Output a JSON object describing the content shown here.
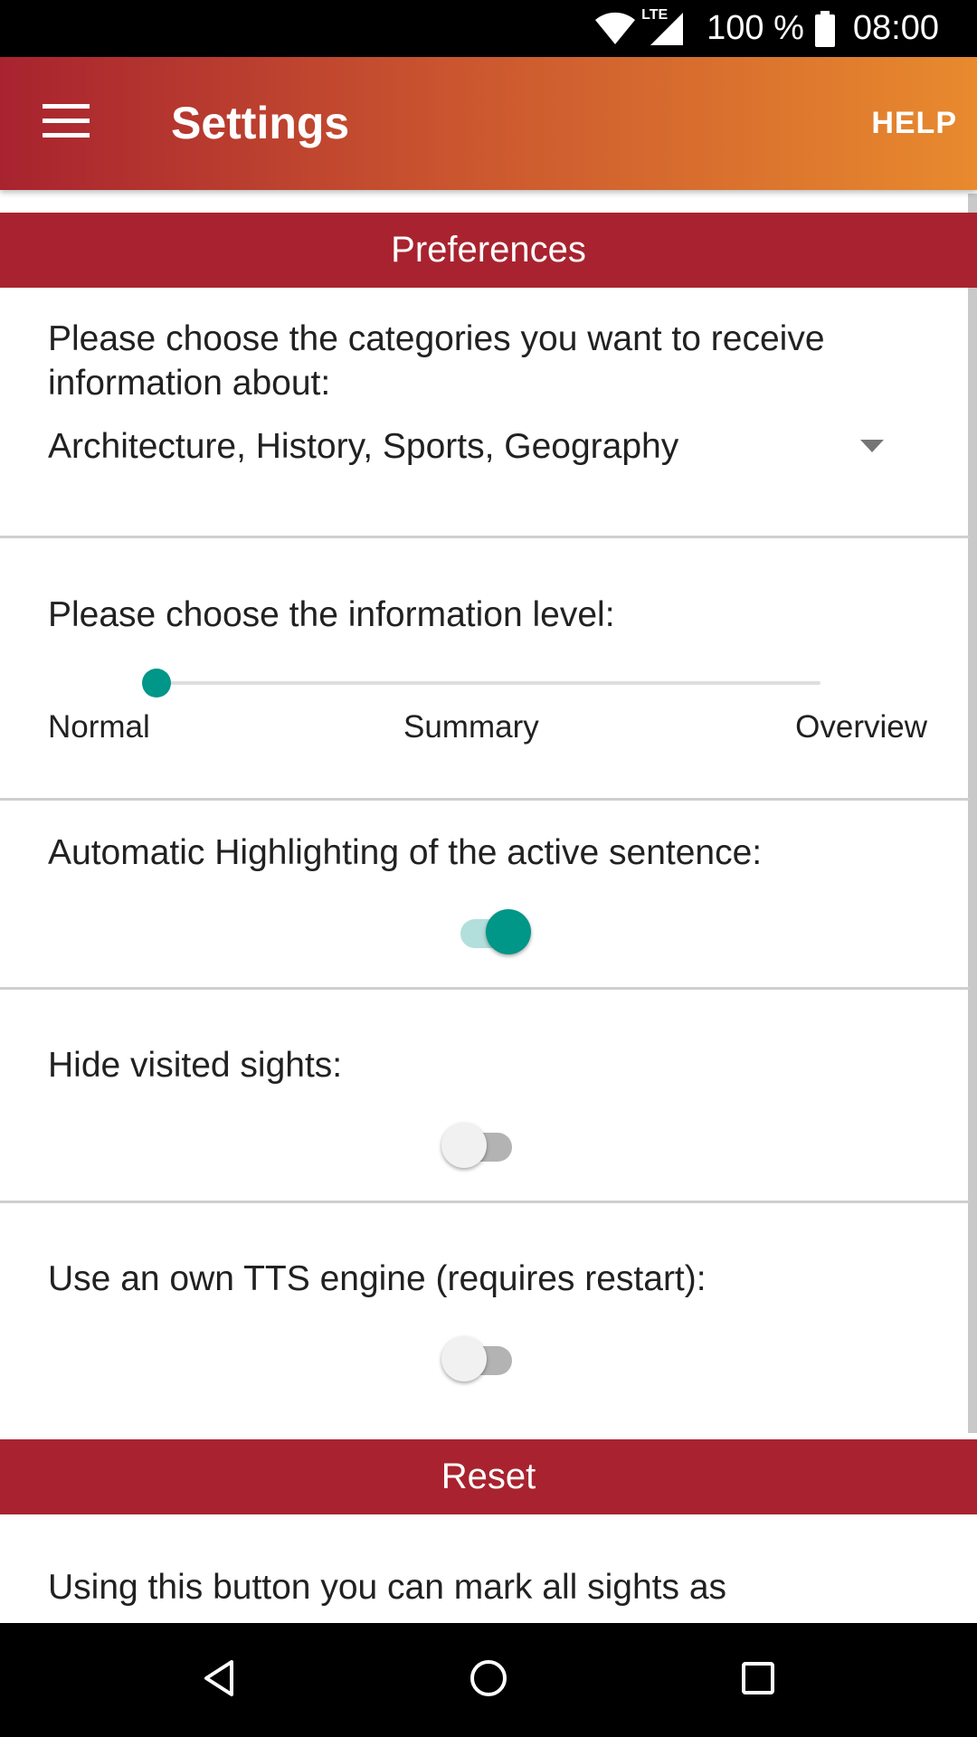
{
  "status_bar": {
    "network": "LTE",
    "battery": "100 %",
    "time": "08:00"
  },
  "app_bar": {
    "title": "Settings",
    "help_label": "HELP"
  },
  "preferences": {
    "header": "Preferences",
    "categories": {
      "prompt": "Please choose the categories you want to receive information about:",
      "selected": "Architecture, History, Sports, Geography"
    },
    "info_level": {
      "prompt": "Please choose the information level:",
      "options": [
        "Normal",
        "Summary",
        "Overview"
      ],
      "selected_index": 0
    },
    "highlighting": {
      "prompt": "Automatic Highlighting of the active sentence:",
      "enabled": true
    },
    "hide_visited": {
      "prompt": "Hide visited sights:",
      "enabled": false
    },
    "own_tts": {
      "prompt": "Use an own TTS engine (requires restart):",
      "enabled": false
    }
  },
  "reset": {
    "header": "Reset",
    "description": "Using this button you can mark all sights as"
  },
  "colors": {
    "accent": "#009688",
    "header": "#a8232f",
    "app_bar_start": "#a8232f",
    "app_bar_end": "#e88a2e"
  },
  "icons": {
    "menu": "menu-icon",
    "wifi": "wifi-icon",
    "signal": "signal-icon",
    "battery": "battery-icon",
    "back": "back-icon",
    "home": "home-icon",
    "recents": "recents-icon"
  }
}
